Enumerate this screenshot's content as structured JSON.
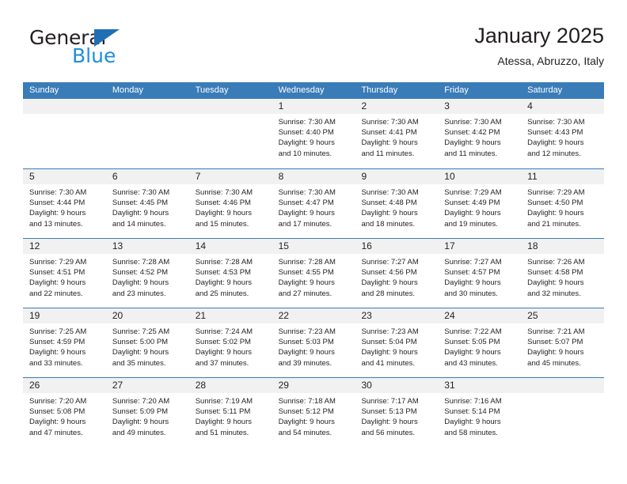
{
  "logo": {
    "word_top": "General",
    "word_bottom": "Blue",
    "triangle_color": "#1f6fb5",
    "blue_color": "#1f8fd6"
  },
  "header": {
    "title": "January 2025",
    "subtitle": "Atessa, Abruzzo, Italy",
    "accent_color": "#3a7cb8",
    "daynum_band_color": "#f1f1f1"
  },
  "weekdays": [
    "Sunday",
    "Monday",
    "Tuesday",
    "Wednesday",
    "Thursday",
    "Friday",
    "Saturday"
  ],
  "weeks": [
    [
      {
        "day": "",
        "lines": []
      },
      {
        "day": "",
        "lines": []
      },
      {
        "day": "",
        "lines": []
      },
      {
        "day": "1",
        "lines": [
          "Sunrise: 7:30 AM",
          "Sunset: 4:40 PM",
          "Daylight: 9 hours",
          "and 10 minutes."
        ]
      },
      {
        "day": "2",
        "lines": [
          "Sunrise: 7:30 AM",
          "Sunset: 4:41 PM",
          "Daylight: 9 hours",
          "and 11 minutes."
        ]
      },
      {
        "day": "3",
        "lines": [
          "Sunrise: 7:30 AM",
          "Sunset: 4:42 PM",
          "Daylight: 9 hours",
          "and 11 minutes."
        ]
      },
      {
        "day": "4",
        "lines": [
          "Sunrise: 7:30 AM",
          "Sunset: 4:43 PM",
          "Daylight: 9 hours",
          "and 12 minutes."
        ]
      }
    ],
    [
      {
        "day": "5",
        "lines": [
          "Sunrise: 7:30 AM",
          "Sunset: 4:44 PM",
          "Daylight: 9 hours",
          "and 13 minutes."
        ]
      },
      {
        "day": "6",
        "lines": [
          "Sunrise: 7:30 AM",
          "Sunset: 4:45 PM",
          "Daylight: 9 hours",
          "and 14 minutes."
        ]
      },
      {
        "day": "7",
        "lines": [
          "Sunrise: 7:30 AM",
          "Sunset: 4:46 PM",
          "Daylight: 9 hours",
          "and 15 minutes."
        ]
      },
      {
        "day": "8",
        "lines": [
          "Sunrise: 7:30 AM",
          "Sunset: 4:47 PM",
          "Daylight: 9 hours",
          "and 17 minutes."
        ]
      },
      {
        "day": "9",
        "lines": [
          "Sunrise: 7:30 AM",
          "Sunset: 4:48 PM",
          "Daylight: 9 hours",
          "and 18 minutes."
        ]
      },
      {
        "day": "10",
        "lines": [
          "Sunrise: 7:29 AM",
          "Sunset: 4:49 PM",
          "Daylight: 9 hours",
          "and 19 minutes."
        ]
      },
      {
        "day": "11",
        "lines": [
          "Sunrise: 7:29 AM",
          "Sunset: 4:50 PM",
          "Daylight: 9 hours",
          "and 21 minutes."
        ]
      }
    ],
    [
      {
        "day": "12",
        "lines": [
          "Sunrise: 7:29 AM",
          "Sunset: 4:51 PM",
          "Daylight: 9 hours",
          "and 22 minutes."
        ]
      },
      {
        "day": "13",
        "lines": [
          "Sunrise: 7:28 AM",
          "Sunset: 4:52 PM",
          "Daylight: 9 hours",
          "and 23 minutes."
        ]
      },
      {
        "day": "14",
        "lines": [
          "Sunrise: 7:28 AM",
          "Sunset: 4:53 PM",
          "Daylight: 9 hours",
          "and 25 minutes."
        ]
      },
      {
        "day": "15",
        "lines": [
          "Sunrise: 7:28 AM",
          "Sunset: 4:55 PM",
          "Daylight: 9 hours",
          "and 27 minutes."
        ]
      },
      {
        "day": "16",
        "lines": [
          "Sunrise: 7:27 AM",
          "Sunset: 4:56 PM",
          "Daylight: 9 hours",
          "and 28 minutes."
        ]
      },
      {
        "day": "17",
        "lines": [
          "Sunrise: 7:27 AM",
          "Sunset: 4:57 PM",
          "Daylight: 9 hours",
          "and 30 minutes."
        ]
      },
      {
        "day": "18",
        "lines": [
          "Sunrise: 7:26 AM",
          "Sunset: 4:58 PM",
          "Daylight: 9 hours",
          "and 32 minutes."
        ]
      }
    ],
    [
      {
        "day": "19",
        "lines": [
          "Sunrise: 7:25 AM",
          "Sunset: 4:59 PM",
          "Daylight: 9 hours",
          "and 33 minutes."
        ]
      },
      {
        "day": "20",
        "lines": [
          "Sunrise: 7:25 AM",
          "Sunset: 5:00 PM",
          "Daylight: 9 hours",
          "and 35 minutes."
        ]
      },
      {
        "day": "21",
        "lines": [
          "Sunrise: 7:24 AM",
          "Sunset: 5:02 PM",
          "Daylight: 9 hours",
          "and 37 minutes."
        ]
      },
      {
        "day": "22",
        "lines": [
          "Sunrise: 7:23 AM",
          "Sunset: 5:03 PM",
          "Daylight: 9 hours",
          "and 39 minutes."
        ]
      },
      {
        "day": "23",
        "lines": [
          "Sunrise: 7:23 AM",
          "Sunset: 5:04 PM",
          "Daylight: 9 hours",
          "and 41 minutes."
        ]
      },
      {
        "day": "24",
        "lines": [
          "Sunrise: 7:22 AM",
          "Sunset: 5:05 PM",
          "Daylight: 9 hours",
          "and 43 minutes."
        ]
      },
      {
        "day": "25",
        "lines": [
          "Sunrise: 7:21 AM",
          "Sunset: 5:07 PM",
          "Daylight: 9 hours",
          "and 45 minutes."
        ]
      }
    ],
    [
      {
        "day": "26",
        "lines": [
          "Sunrise: 7:20 AM",
          "Sunset: 5:08 PM",
          "Daylight: 9 hours",
          "and 47 minutes."
        ]
      },
      {
        "day": "27",
        "lines": [
          "Sunrise: 7:20 AM",
          "Sunset: 5:09 PM",
          "Daylight: 9 hours",
          "and 49 minutes."
        ]
      },
      {
        "day": "28",
        "lines": [
          "Sunrise: 7:19 AM",
          "Sunset: 5:11 PM",
          "Daylight: 9 hours",
          "and 51 minutes."
        ]
      },
      {
        "day": "29",
        "lines": [
          "Sunrise: 7:18 AM",
          "Sunset: 5:12 PM",
          "Daylight: 9 hours",
          "and 54 minutes."
        ]
      },
      {
        "day": "30",
        "lines": [
          "Sunrise: 7:17 AM",
          "Sunset: 5:13 PM",
          "Daylight: 9 hours",
          "and 56 minutes."
        ]
      },
      {
        "day": "31",
        "lines": [
          "Sunrise: 7:16 AM",
          "Sunset: 5:14 PM",
          "Daylight: 9 hours",
          "and 58 minutes."
        ]
      },
      {
        "day": "",
        "lines": []
      }
    ]
  ]
}
